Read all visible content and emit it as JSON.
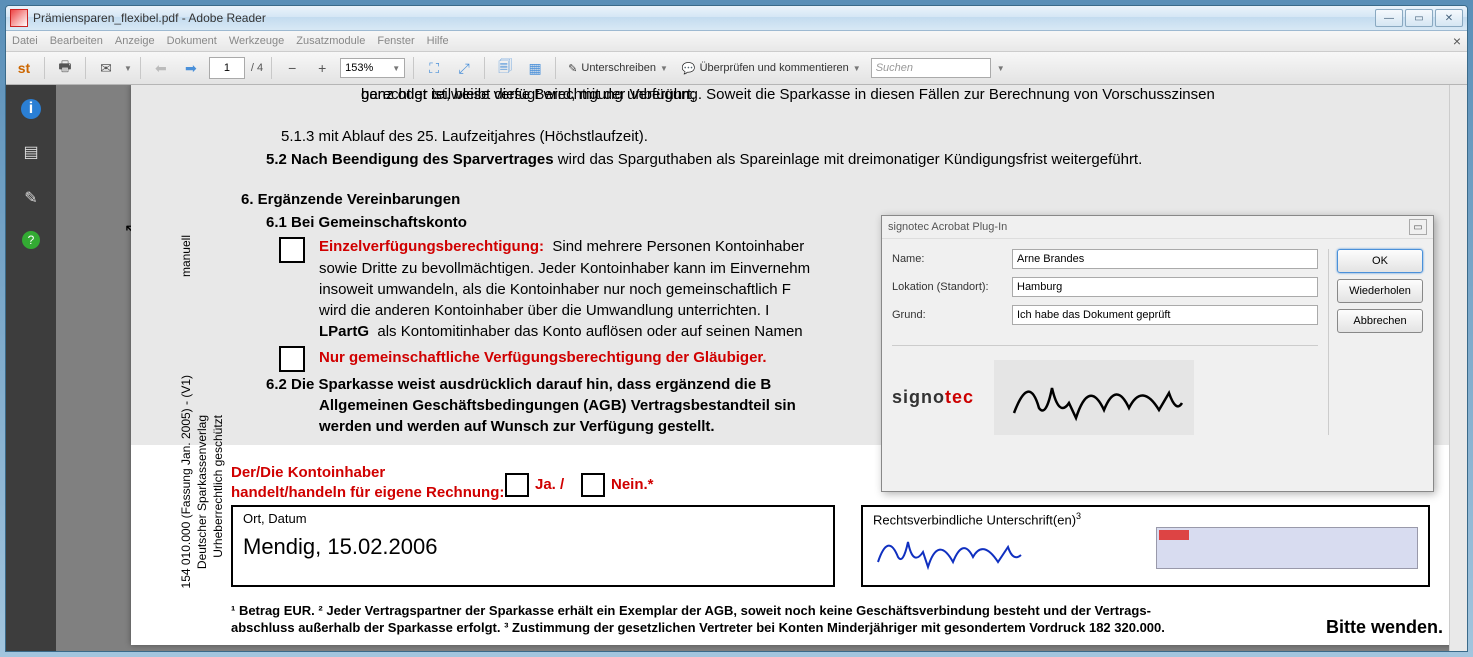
{
  "window": {
    "title": "Prämiensparen_flexibel.pdf - Adobe Reader"
  },
  "menu": {
    "file": "Datei",
    "edit": "Bearbeiten",
    "view": "Anzeige",
    "document": "Dokument",
    "tools": "Werkzeuge",
    "extras": "Zusatzmodule",
    "window": "Fenster",
    "help": "Hilfe"
  },
  "toolbar": {
    "page_current": "1",
    "page_total": "/ 4",
    "zoom": "153%",
    "sign": "Unterschreiben",
    "review": "Überprüfen und kommentieren",
    "search_placeholder": "Suchen"
  },
  "doc": {
    "line_top": "ganz oder teilweise verfügt wird, mit der Verfügung. Soweit die Sparkasse in diesen Fällen zur Berechnung von Vorschusszinsen",
    "line_top2": "berechtigt ist, bleibt diese Berechtigung unberührt;",
    "c513": "5.1.3  mit Ablauf des 25. Laufzeitjahres (Höchstlaufzeit).",
    "c52_lead": "5.2   Nach Beendigung des Sparvertrages",
    "c52_rest": " wird das Sparguthaben als Spareinlage mit dreimonatiger Kündigungsfrist weitergeführt.",
    "h6": "6.    Ergänzende Vereinbarungen",
    "h61": "6.1   Bei Gemeinschaftskonto",
    "einzel_label": "Einzelverfügungsberechtigung:",
    "einzel_txt1": "Sind mehrere Personen Kontoinhaber",
    "einzel_txt2": "sowie Dritte zu bevollmächtigen. Jeder Kontoinhaber kann im Einvernehm",
    "einzel_txt3": "insoweit umwandeln, als die Kontoinhaber nur noch gemeinschaftlich F",
    "einzel_txt4": "wird die anderen Kontoinhaber über die Umwandlung unterrichten. I",
    "einzel_txt5": "LPartG  als Kontomitinhaber das Konto auflösen oder auf seinen Namen",
    "nur_gem": "Nur gemeinschaftliche Verfügungsberechtigung der Gläubiger.",
    "h62_l1": "6.2   Die Sparkasse weist ausdrücklich darauf hin, dass ergänzend die B",
    "h62_l2": "Allgemeinen Geschäftsbedingungen (AGB) Vertragsbestandteil sin",
    "h62_l3": "werden und werden auf Wunsch zur Verfügung gestellt.",
    "owner_l1": "Der/Die Kontoinhaber",
    "owner_l2": "handelt/handeln für eigene Rechnung:",
    "ja": "Ja. /",
    "nein": "Nein.*",
    "ort_label": "Ort, Datum",
    "ort_value": "Mendig, 15.02.2006",
    "sig_label": "Rechtsverbindliche Unterschrift(en)",
    "foot1": "¹ Betrag EUR. ² Jeder Vertragspartner der Sparkasse erhält ein Exemplar der AGB, soweit noch keine Geschäftsverbindung besteht und der Vertrags-",
    "foot2": "abschluss außerhalb der Sparkasse erfolgt. ³ Zustimmung der gesetzlichen Vertreter bei Konten Minderjähriger mit gesondertem Vordruck 182 320.000.",
    "bitte": "Bitte wenden.",
    "vert1": "154 010.000 (Fassung Jan. 2005) - (V1)",
    "vert2": "Deutscher Sparkassenverlag",
    "vert3": "Urheberrechtlich geschützt",
    "vert4": "manuell"
  },
  "dialog": {
    "title": "signotec Acrobat Plug-In",
    "name_lbl": "Name:",
    "name_val": "Arne Brandes",
    "loc_lbl": "Lokation (Standort):",
    "loc_val": "Hamburg",
    "reason_lbl": "Grund:",
    "reason_val": "Ich habe das Dokument geprüft",
    "ok": "OK",
    "repeat": "Wiederholen",
    "cancel": "Abbrechen"
  }
}
